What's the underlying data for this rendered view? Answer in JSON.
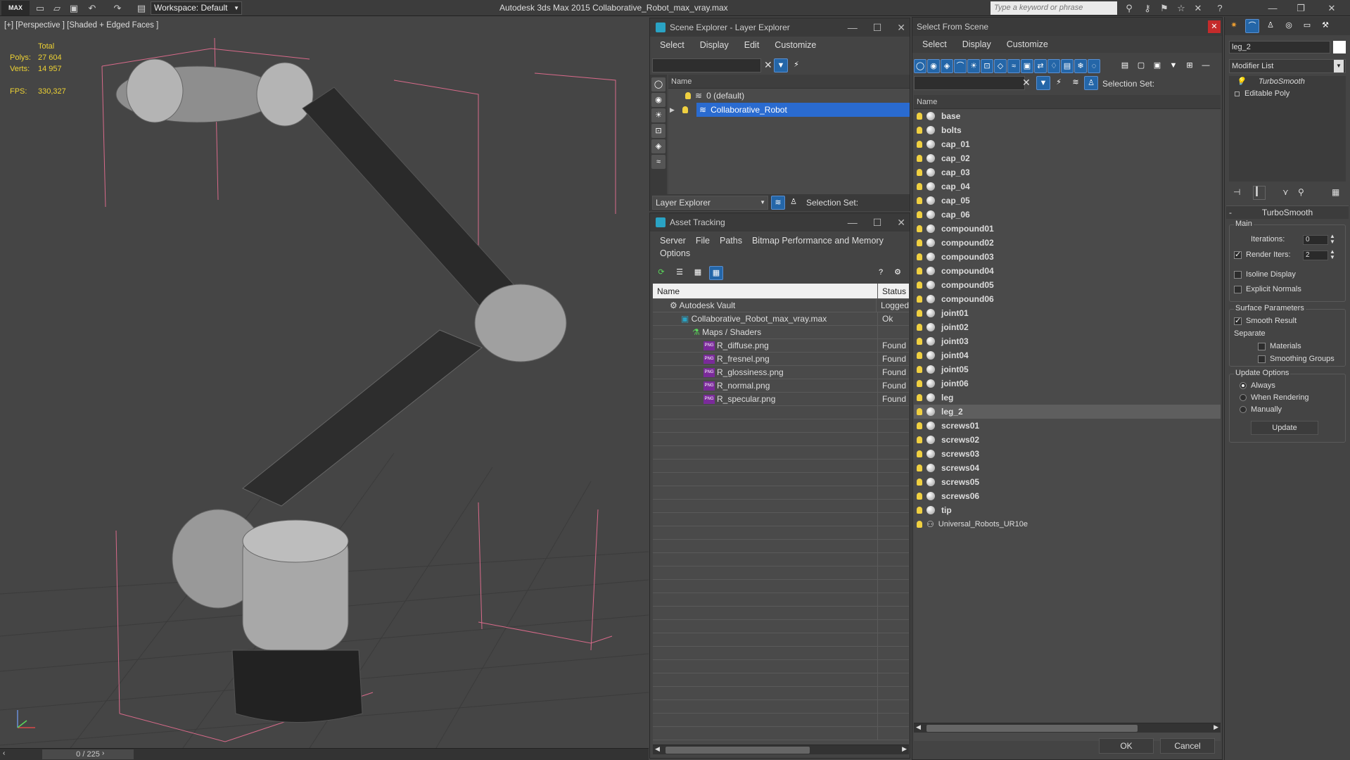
{
  "app": {
    "logo": "MAX",
    "workspace": "Workspace: Default",
    "title": "Autodesk 3ds Max  2015    Collaborative_Robot_max_vray.max",
    "search_placeholder": "Type a keyword or phrase"
  },
  "viewport": {
    "label": "[+] [Perspective ] [Shaded + Edged Faces ]",
    "stats": {
      "total_label": "Total",
      "polys_label": "Polys:",
      "polys": "27 604",
      "verts_label": "Verts:",
      "verts": "14 957",
      "fps_label": "FPS:",
      "fps": "330,327"
    },
    "timeline": "0 / 225"
  },
  "scene_explorer": {
    "title": "Scene Explorer - Layer Explorer",
    "menu": [
      "Select",
      "Display",
      "Edit",
      "Customize"
    ],
    "column": "Name",
    "layers": [
      "0 (default)",
      "Collaborative_Robot"
    ],
    "footer_dropdown": "Layer Explorer",
    "selection_set": "Selection Set:"
  },
  "asset_tracking": {
    "title": "Asset Tracking",
    "menu": [
      "Server",
      "File",
      "Paths",
      "Bitmap Performance and Memory"
    ],
    "menu2": "Options",
    "col_name": "Name",
    "col_status": "Status",
    "rows": [
      {
        "name": "Autodesk Vault",
        "status": "Logged"
      },
      {
        "name": "Collaborative_Robot_max_vray.max",
        "status": "Ok"
      },
      {
        "name": "Maps / Shaders",
        "status": ""
      },
      {
        "name": "R_diffuse.png",
        "status": "Found"
      },
      {
        "name": "R_fresnel.png",
        "status": "Found"
      },
      {
        "name": "R_glossiness.png",
        "status": "Found"
      },
      {
        "name": "R_normal.png",
        "status": "Found"
      },
      {
        "name": "R_specular.png",
        "status": "Found"
      }
    ]
  },
  "select_from_scene": {
    "title": "Select From Scene",
    "menu": [
      "Select",
      "Display",
      "Customize"
    ],
    "selection_set": "Selection Set:",
    "column": "Name",
    "objects": [
      "base",
      "bolts",
      "cap_01",
      "cap_02",
      "cap_03",
      "cap_04",
      "cap_05",
      "cap_06",
      "compound01",
      "compound02",
      "compound03",
      "compound04",
      "compound05",
      "compound06",
      "joint01",
      "joint02",
      "joint03",
      "joint04",
      "joint05",
      "joint06",
      "leg",
      "leg_2",
      "screws01",
      "screws02",
      "screws03",
      "screws04",
      "screws05",
      "screws06",
      "tip",
      "Universal_Robots_UR10e"
    ],
    "selected": "leg_2",
    "ok": "OK",
    "cancel": "Cancel"
  },
  "modify_panel": {
    "object_name": "leg_2",
    "modifier_list": "Modifier List",
    "stack": [
      "TurboSmooth",
      "Editable Poly"
    ],
    "rollout_title": "TurboSmooth",
    "main_label": "Main",
    "iterations_label": "Iterations:",
    "iterations": "0",
    "render_iters_label": "Render Iters:",
    "render_iters": "2",
    "isoline": "Isoline Display",
    "explicit_normals": "Explicit Normals",
    "surface_params": "Surface Parameters",
    "smooth_result": "Smooth Result",
    "separate": "Separate",
    "materials": "Materials",
    "smoothing_groups": "Smoothing Groups",
    "update_options": "Update Options",
    "always": "Always",
    "when_rendering": "When Rendering",
    "manually": "Manually",
    "update_btn": "Update"
  }
}
